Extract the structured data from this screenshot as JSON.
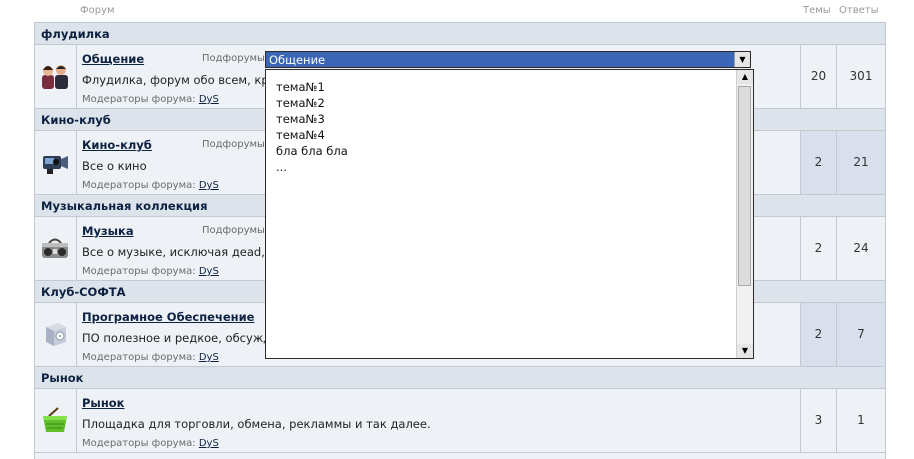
{
  "header": {
    "forum": "Форум",
    "topics": "Темы",
    "replies": "Ответы"
  },
  "categories": [
    {
      "title": "флудилка"
    },
    {
      "title": "Кино-клуб"
    },
    {
      "title": "Музыкальная коллекция"
    },
    {
      "title": "Клуб-СОФТА"
    },
    {
      "title": "Рынок"
    }
  ],
  "forums": [
    {
      "name": "Общение",
      "subforums": "Подфорумы",
      "desc": "Флудилка, форум обо всем, кро",
      "mods_label": "Модераторы форума:",
      "moderator": "DyS",
      "topics": "20",
      "replies": "301",
      "icon": "people-icon"
    },
    {
      "name": "Кино-клуб",
      "subforums": "Подфорумы",
      "desc": "Все о кино",
      "mods_label": "Модераторы форума:",
      "moderator": "DyS",
      "topics": "2",
      "replies": "21",
      "icon": "video-camera-icon"
    },
    {
      "name": "Музыка",
      "subforums": "Подфорумы",
      "desc": "Все о музыке, исключая дead, т",
      "mods_label": "Модераторы форума:",
      "moderator": "DyS",
      "topics": "2",
      "replies": "24",
      "icon": "boombox-icon"
    },
    {
      "name": "Програмное Обеспечение",
      "subforums": "",
      "desc": "ПО полезное и редкое, обсужд",
      "mods_label": "Модераторы форума:",
      "moderator": "DyS",
      "topics": "2",
      "replies": "7",
      "icon": "software-box-icon"
    },
    {
      "name": "Рынок",
      "subforums": "",
      "desc": "Площадка для торговли, обмена, рекламмы и так далее.",
      "mods_label": "Модераторы форума:",
      "moderator": "DyS",
      "topics": "3",
      "replies": "1",
      "icon": "basket-icon"
    }
  ],
  "dropdown": {
    "selected": "Общение",
    "options": [
      "тема№1",
      "тема№2",
      "тема№3",
      "тема№4",
      "бла бла бла",
      "..."
    ]
  }
}
